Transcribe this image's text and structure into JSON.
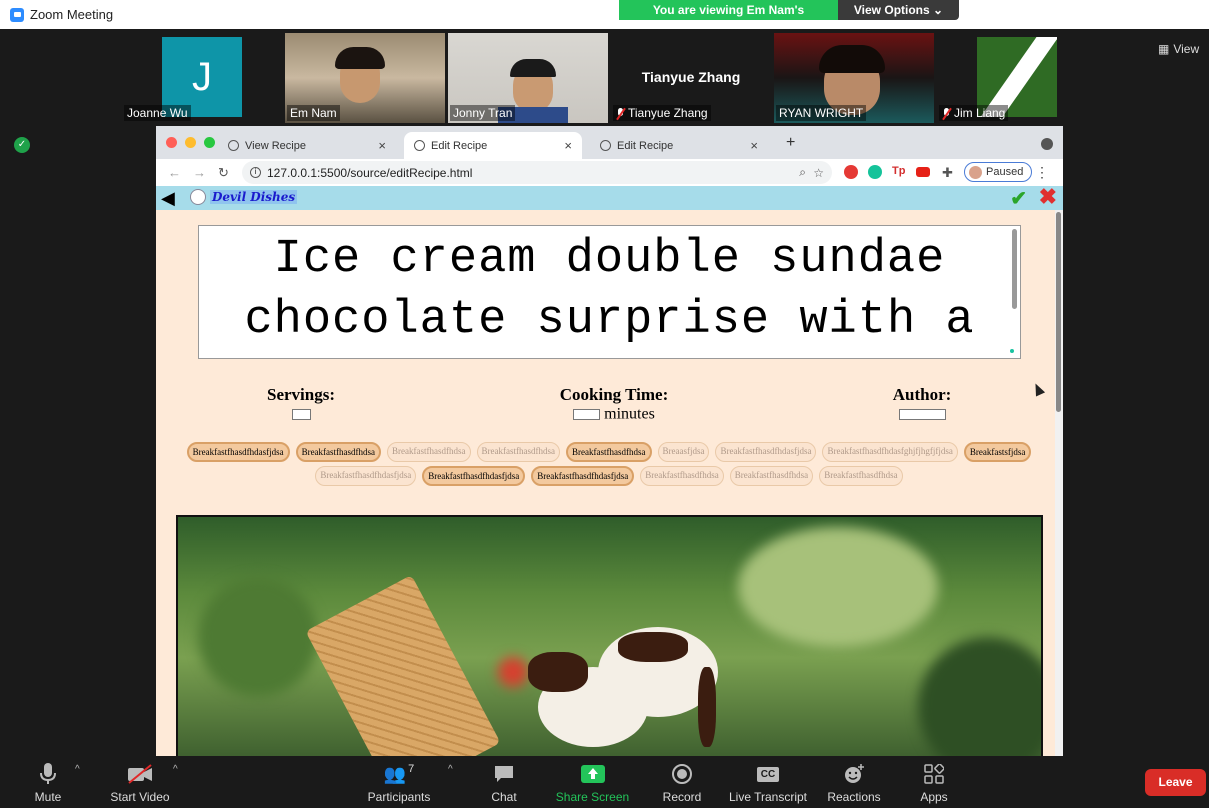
{
  "app": {
    "title": "Zoom Meeting"
  },
  "share_banner": {
    "viewing": "You are viewing Em Nam's screen",
    "view_options": "View Options"
  },
  "view_button": "View",
  "participants": [
    {
      "name": "Joanne Wu",
      "muted": false
    },
    {
      "name": "Em Nam",
      "muted": false
    },
    {
      "name": "Jonny Tran",
      "muted": false
    },
    {
      "name": "Tianyue Zhang",
      "muted": true,
      "display": "Tianyue Zhang"
    },
    {
      "name": "RYAN WRIGHT",
      "muted": false
    },
    {
      "name": "Jim Liang",
      "muted": true
    }
  ],
  "joanne_initial": "J",
  "browser": {
    "tabs": [
      {
        "label": "View Recipe"
      },
      {
        "label": "Edit Recipe"
      },
      {
        "label": "Edit Recipe"
      }
    ],
    "url": "127.0.0.1:5500/source/editRecipe.html",
    "profile_status": "Paused"
  },
  "page": {
    "brand": "Devil Dishes",
    "recipe_title": "Ice cream double sundae chocolate surprise with a",
    "servings_label": "Servings:",
    "cooking_time_label": "Cooking Time:",
    "minutes_unit": "minutes",
    "author_label": "Author:",
    "tags": [
      {
        "text": "Breakfastfhasdfhdasfjdsa",
        "selected": true
      },
      {
        "text": "Breakfastfhasdfhdsa",
        "selected": true
      },
      {
        "text": "Breakfastfhasdfhdsa",
        "selected": false
      },
      {
        "text": "Breakfastfhasdfhdsa",
        "selected": false
      },
      {
        "text": "Breakfastfhasdfhdsa",
        "selected": true
      },
      {
        "text": "Breaasfjdsa",
        "selected": false
      },
      {
        "text": "Breakfastfhasdfhdasfjdsa",
        "selected": false
      },
      {
        "text": "Breakfastfhasdfhdasfghjfjhgfjfjdsa",
        "selected": false
      },
      {
        "text": "Breakfastsfjdsa",
        "selected": true
      },
      {
        "text": "Breakfastfhasdfhdasfjdsa",
        "selected": false
      },
      {
        "text": "Breakfastfhasdfhdasfjdsa",
        "selected": true
      },
      {
        "text": "Breakfastfhasdfhdasfjdsa",
        "selected": true
      },
      {
        "text": "Breakfastfhasdfhdsa",
        "selected": false
      },
      {
        "text": "Breakfastfhasdfhdsa",
        "selected": false
      },
      {
        "text": "Breakfastfhasdfhdsa",
        "selected": false
      }
    ]
  },
  "controls": {
    "mute": "Mute",
    "start_video": "Start Video",
    "participants": "Participants",
    "participants_count": "7",
    "chat": "Chat",
    "share_screen": "Share Screen",
    "record": "Record",
    "live_transcript": "Live Transcript",
    "reactions": "Reactions",
    "apps": "Apps",
    "leave": "Leave"
  },
  "colors": {
    "zoom_green": "#23c45a",
    "leave_red": "#d92d27",
    "app_bar": "#a6dcea",
    "page_bg": "#feead8"
  }
}
